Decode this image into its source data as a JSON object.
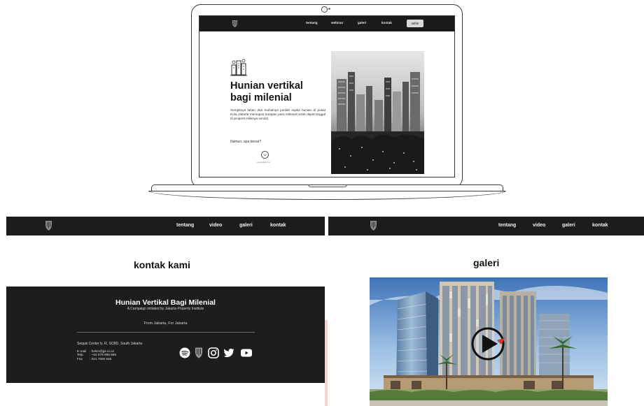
{
  "laptop_screen": {
    "nav": {
      "items": [
        "tentang",
        "webinar",
        "galeri",
        "kontak"
      ],
      "button": "daftar"
    },
    "hero": {
      "title_line1": "Hunian vertikal",
      "title_line2": "bagi milenial",
      "body": "Sempitnya lahan dan mahalnya jumlah suplai hunian di pusat Kota Jakarta memupus harapan para milenial untuk dapat tinggal di properti miliknya sendiri.",
      "question": "Namun, apa benar?",
      "scroll_label": "selengkapnya"
    }
  },
  "left_panel": {
    "nav": {
      "items": [
        "tentang",
        "video",
        "galeri",
        "kontak"
      ]
    },
    "section_title": "kontak kami",
    "footer": {
      "title": "Hunian Vertikal Bagi Milenial",
      "subtitle": "A Campaign initiated by Jakarta Property Institute",
      "from": "From Jakarta, For Jakarta",
      "address": "Sequis Center lv. R, SCBD, South Jakarta",
      "contacts": [
        {
          "label": "E-mail",
          "value": ": hvbm@jpi.co.id"
        },
        {
          "label": "Telp.",
          "value": ": +62 878 998 889"
        },
        {
          "label": "Fax",
          "value": ": 021 7665 556"
        }
      ],
      "social_icons": [
        "spotify-icon",
        "jpi-logo-icon",
        "instagram-icon",
        "twitter-icon",
        "youtube-icon"
      ]
    }
  },
  "right_panel": {
    "nav": {
      "items": [
        "tentang",
        "video",
        "galeri",
        "kontak"
      ]
    },
    "section_title": "galeri",
    "video": {
      "icon": "play-icon"
    }
  },
  "colors": {
    "nav_bg": "#1c1c1c",
    "footer_bg": "#1d1d1d",
    "text": "#121212",
    "accent_red": "#d23a2a"
  }
}
